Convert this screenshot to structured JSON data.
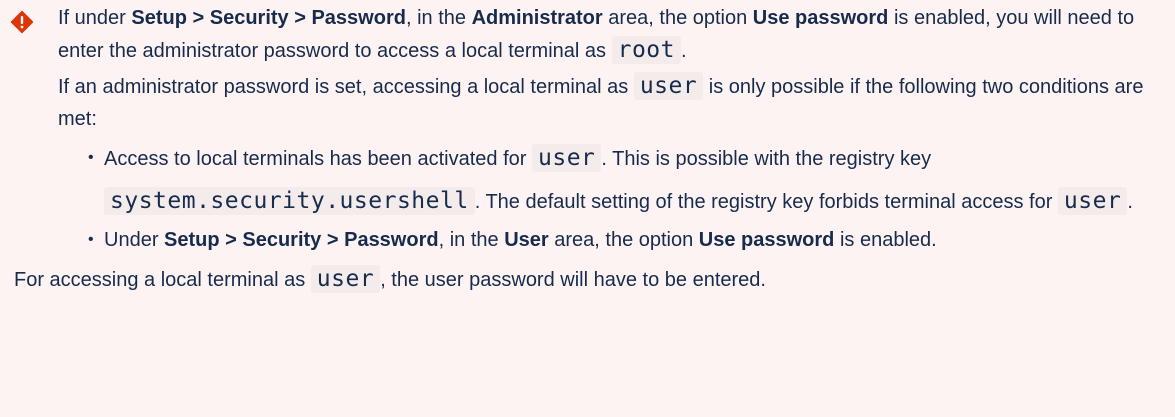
{
  "note": {
    "icon": "warning-diamond-icon",
    "accent_color": "#de350b",
    "background_color": "#fdf3f2",
    "p1": {
      "t1": "If under ",
      "b1": "Setup > Security > Password",
      "t2": ", in the ",
      "b2": "Administrator",
      "t3": " area, the option ",
      "b3": "Use password",
      "t4": " is enabled, you will need to enter the administrator password to access a local terminal as ",
      "c1": "root",
      "t5": "."
    },
    "p2": {
      "t1": "If an administrator password is set, accessing a local terminal as ",
      "c1": "user",
      "t2": " is only possible if the following two conditions are met:"
    },
    "list": [
      {
        "t1": "Access to local terminals has been activated for ",
        "c1": "user",
        "t2": ". This is possible with the registry key ",
        "c2": "system.security.usershell",
        "t3": ". The default setting of the registry key forbids terminal access for ",
        "c3": "user",
        "t4": "."
      },
      {
        "t1": "Under ",
        "b1": "Setup > Security > Password",
        "t2": ", in the ",
        "b2": "User",
        "t3": " area,  the option ",
        "b3": "Use password",
        "t4": " is enabled."
      }
    ],
    "p3": {
      "t1": "For accessing a local terminal as ",
      "c1": "user",
      "t2": ", the user password will have to be entered."
    }
  }
}
